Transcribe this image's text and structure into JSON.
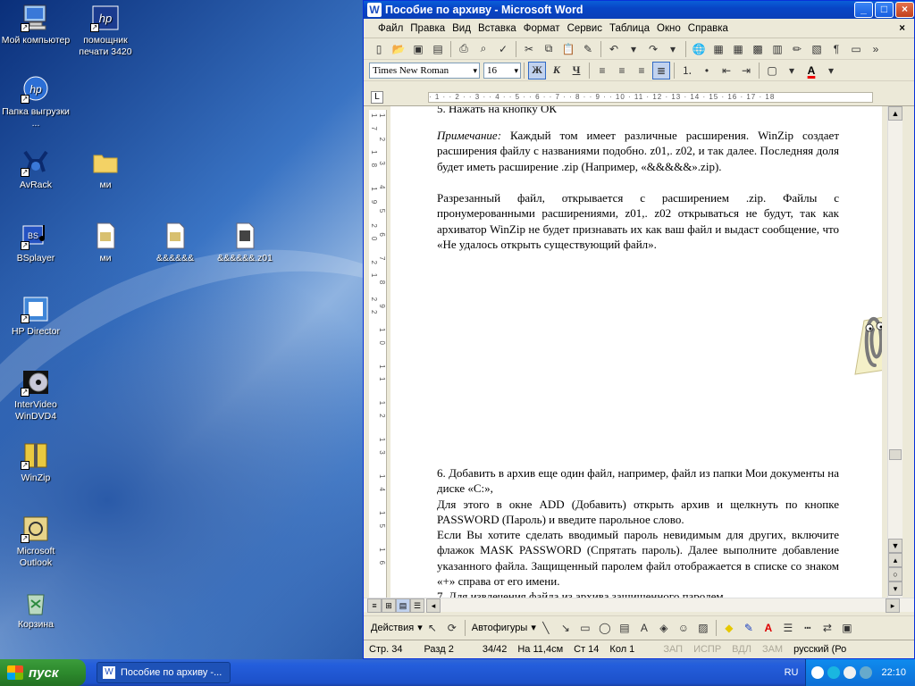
{
  "desktop": {
    "icons": [
      {
        "label": "Мой компьютер",
        "icon": "my-computer-icon"
      },
      {
        "label": "помощник печати 3420",
        "icon": "hp-icon"
      },
      {
        "label": "Папка выгрузки ...",
        "icon": "hp-folder-icon"
      },
      {
        "label": "AvRack",
        "icon": "avrack-icon"
      },
      {
        "label": "ми",
        "icon": "folder-icon"
      },
      {
        "label": "BSplayer",
        "icon": "bsplayer-icon"
      },
      {
        "label": "ми",
        "icon": "file-icon"
      },
      {
        "label": "&&&&&&",
        "icon": "file-icon"
      },
      {
        "label": "&&&&&&.z01",
        "icon": "file-icon"
      },
      {
        "label": "HP Director",
        "icon": "hp-director-icon"
      },
      {
        "label": "InterVideo WinDVD4",
        "icon": "windvd-icon"
      },
      {
        "label": "WinZip",
        "icon": "winzip-icon"
      },
      {
        "label": "Microsoft Outlook",
        "icon": "outlook-icon"
      },
      {
        "label": "Корзина",
        "icon": "recycle-bin-icon"
      }
    ]
  },
  "window": {
    "title": "Пособие по архиву - Microsoft Word",
    "minimize": "_",
    "maximize": "□",
    "close": "×"
  },
  "menu": [
    "Файл",
    "Правка",
    "Вид",
    "Вставка",
    "Формат",
    "Сервис",
    "Таблица",
    "Окно",
    "Справка"
  ],
  "menu_close": "×",
  "format": {
    "font": "Times New Roman",
    "size": "16",
    "bold": "Ж",
    "italic": "К",
    "underline": "Ч",
    "font_color_label": "A"
  },
  "ruler": {
    "marks": "· 1 · · 2 · · 3 · · 4 · · 5 · · 6 · · 7 · · 8 · · 9 · · 10 · 11 · 12 · 13 · 14 · 15 · 16 · 17 · 18",
    "vmarks": "1 2 3 4 5 6 7 8 9 10 11 12 13 14 15 16 17 18 19 20 21 22"
  },
  "document": {
    "p0": "5. Нажать на кнопку ОК",
    "p1_a": "Примечание:",
    "p1_b": " Каждый том имеет различные расширения. WinZip создает расширения файлу с названиями подобно. z01,. z02, и так далее. Последняя доля будет иметь расширение .zip (Например, «&&&&&».zip).",
    "p2": "Разрезанный файл, открывается с расширением .zip. Файлы с пронумерованными расширениями, z01,. z02 открываться не будут, так как архиватор WinZip не будет признавать их как ваш файл и выдаст сообщение, что «Не удалось открыть существующий файл».",
    "p3": "6. Добавить в архив еще один файл, например, файл из папки Мои документы на диске «С:»,",
    "p4": "Для этого в окне ADD (Добавить) открыть архив и щелкнуть по кнопке PASSWORD (Пароль) и введите парольное слово.",
    "p5": "Если Вы хотите сделать вводимый пароль невидимым для других, включите флажок MASK PASSWORD (Спрятать пароль). Далее выполните добавление указанного файла. Защищенный паролем файл отображается в списке со знаком «+» справа от его имени.",
    "p6": "7. Для извлечения файла из архива защищенного паролем"
  },
  "drawing": {
    "actions": "Действия",
    "autoshapes": "Автофигуры"
  },
  "status": {
    "page": "Стр. 34",
    "section": "Разд 2",
    "pages": "34/42",
    "at": "На 11,4см",
    "line": "Ст 14",
    "col": "Кол 1",
    "rec": "ЗАП",
    "trk": "ИСПР",
    "ext": "ВДЛ",
    "ovr": "ЗАМ",
    "lang": "русский (Ро"
  },
  "taskbar": {
    "start": "пуск",
    "task": "Пособие по архиву -...",
    "lang": "RU",
    "clock": "22:10"
  }
}
